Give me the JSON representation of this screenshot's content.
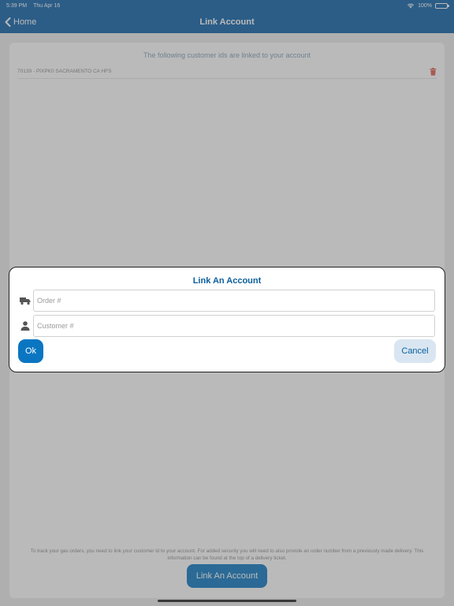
{
  "status_bar": {
    "time": "5:39 PM",
    "date": "Thu Apr 16",
    "battery": "100%",
    "wifi_icon": "wifi-icon",
    "battery_icon": "battery-icon"
  },
  "nav": {
    "back_label": "Home",
    "back_icon": "chevron-left-icon",
    "title": "Link Account"
  },
  "main": {
    "heading": "The following customer ids are linked to your account",
    "linked_accounts": [
      {
        "text": "70139 - PIXPK0 SACRAMENTO CA HFS",
        "delete_icon": "trash-icon"
      }
    ],
    "footer_note": "To track your gas orders, you need to link your customer id to your account.  For added security you will need to also provide an order number from a previously made delivery.  This information can be found at the top of a delivery ticket.",
    "link_button_label": "Link An Account"
  },
  "dialog": {
    "title": "Link An Account",
    "order_placeholder": "Order #",
    "order_value": "",
    "order_icon": "truck-icon",
    "customer_placeholder": "Customer #",
    "customer_value": "",
    "customer_icon": "person-icon",
    "ok_label": "Ok",
    "cancel_label": "Cancel"
  },
  "colors": {
    "nav_bar": "#0a5fa8",
    "primary_button": "#0a76c2",
    "secondary_button": "#d9e6f1",
    "dialog_title": "#0b5f9c",
    "delete_icon": "#e05a4f"
  }
}
